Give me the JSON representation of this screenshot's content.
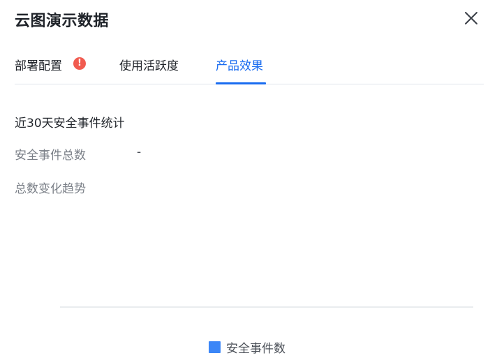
{
  "dialog": {
    "title": "云图演示数据"
  },
  "tabs": [
    {
      "label": "部署配置",
      "badge": "!"
    },
    {
      "label": "使用活跃度"
    },
    {
      "label": "产品效果",
      "active": true
    }
  ],
  "content": {
    "section_title": "近30天安全事件统计",
    "total_label": "安全事件总数",
    "total_value": "-",
    "trend_label": "总数变化趋势"
  },
  "chart_data": {
    "type": "bar",
    "categories": [],
    "series": [
      {
        "name": "安全事件数",
        "values": []
      }
    ],
    "legend_position": "bottom-center",
    "colors": {
      "安全事件数": "#3b86f7"
    }
  },
  "icons": {
    "close": "close-icon",
    "alert": "exclamation-icon"
  },
  "colors": {
    "accent": "#1a6cf0",
    "alert": "#f15b50"
  }
}
